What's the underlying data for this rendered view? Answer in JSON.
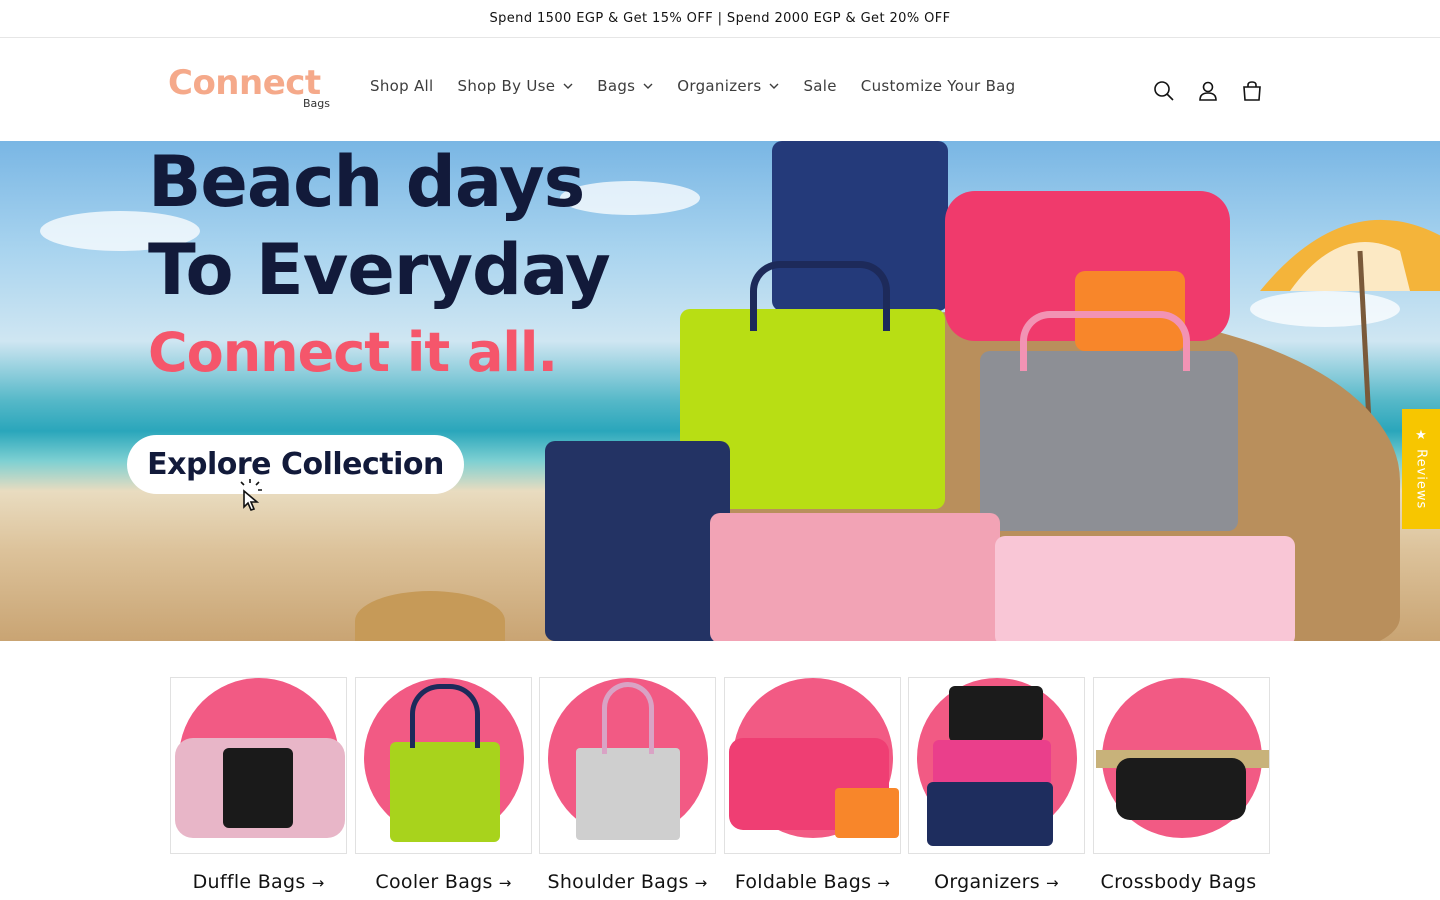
{
  "announcement": "Spend 1500 EGP & Get 15% OFF | Spend 2000 EGP & Get 20% OFF",
  "logo": {
    "main": "Connect",
    "sub": "Bags"
  },
  "nav": [
    {
      "label": "Shop All",
      "has_dropdown": false
    },
    {
      "label": "Shop By Use",
      "has_dropdown": true
    },
    {
      "label": "Bags",
      "has_dropdown": true
    },
    {
      "label": "Organizers",
      "has_dropdown": true
    },
    {
      "label": "Sale",
      "has_dropdown": false
    },
    {
      "label": "Customize Your Bag",
      "has_dropdown": false
    }
  ],
  "header_icons": [
    "search-icon",
    "account-icon",
    "cart-icon"
  ],
  "hero": {
    "line1": "Beach days",
    "line2": "To Everyday",
    "line3": "Connect it all.",
    "cta": "Explore Collection"
  },
  "reviews_tab": "★ Reviews",
  "categories": [
    {
      "label": "Duffle Bags",
      "arrow": "→"
    },
    {
      "label": "Cooler Bags",
      "arrow": "→"
    },
    {
      "label": "Shoulder Bags",
      "arrow": "→"
    },
    {
      "label": "Foldable Bags",
      "arrow": "→"
    },
    {
      "label": "Organizers",
      "arrow": "→"
    },
    {
      "label": "Crossbody Bags",
      "arrow": ""
    }
  ],
  "colors": {
    "accent_pink": "#f5566b",
    "logo_peach": "#f5a98a",
    "navy": "#121a3a",
    "reviews_yellow": "#f7c600",
    "category_circle": "#f25a84"
  }
}
